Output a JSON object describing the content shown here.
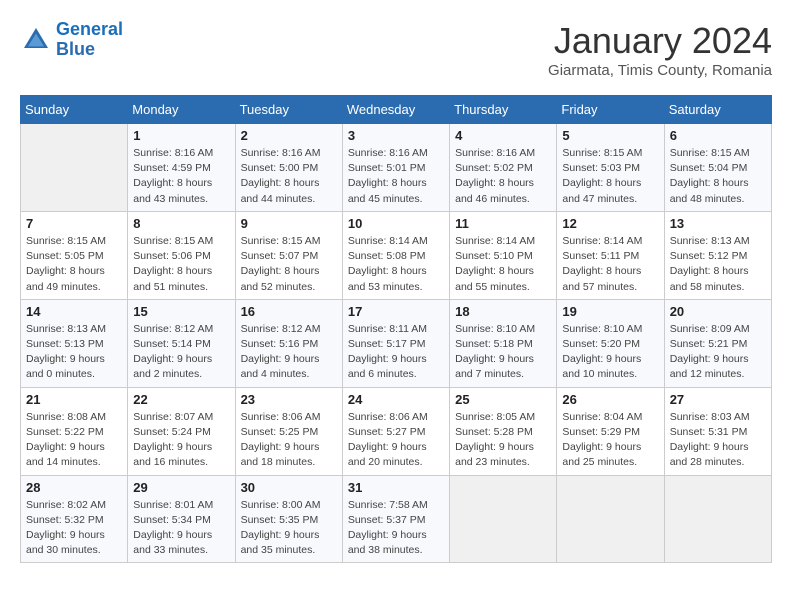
{
  "header": {
    "logo_line1": "General",
    "logo_line2": "Blue",
    "month": "January 2024",
    "location": "Giarmata, Timis County, Romania"
  },
  "weekdays": [
    "Sunday",
    "Monday",
    "Tuesday",
    "Wednesday",
    "Thursday",
    "Friday",
    "Saturday"
  ],
  "weeks": [
    [
      {
        "day": "",
        "info": ""
      },
      {
        "day": "1",
        "info": "Sunrise: 8:16 AM\nSunset: 4:59 PM\nDaylight: 8 hours\nand 43 minutes."
      },
      {
        "day": "2",
        "info": "Sunrise: 8:16 AM\nSunset: 5:00 PM\nDaylight: 8 hours\nand 44 minutes."
      },
      {
        "day": "3",
        "info": "Sunrise: 8:16 AM\nSunset: 5:01 PM\nDaylight: 8 hours\nand 45 minutes."
      },
      {
        "day": "4",
        "info": "Sunrise: 8:16 AM\nSunset: 5:02 PM\nDaylight: 8 hours\nand 46 minutes."
      },
      {
        "day": "5",
        "info": "Sunrise: 8:15 AM\nSunset: 5:03 PM\nDaylight: 8 hours\nand 47 minutes."
      },
      {
        "day": "6",
        "info": "Sunrise: 8:15 AM\nSunset: 5:04 PM\nDaylight: 8 hours\nand 48 minutes."
      }
    ],
    [
      {
        "day": "7",
        "info": "Sunrise: 8:15 AM\nSunset: 5:05 PM\nDaylight: 8 hours\nand 49 minutes."
      },
      {
        "day": "8",
        "info": "Sunrise: 8:15 AM\nSunset: 5:06 PM\nDaylight: 8 hours\nand 51 minutes."
      },
      {
        "day": "9",
        "info": "Sunrise: 8:15 AM\nSunset: 5:07 PM\nDaylight: 8 hours\nand 52 minutes."
      },
      {
        "day": "10",
        "info": "Sunrise: 8:14 AM\nSunset: 5:08 PM\nDaylight: 8 hours\nand 53 minutes."
      },
      {
        "day": "11",
        "info": "Sunrise: 8:14 AM\nSunset: 5:10 PM\nDaylight: 8 hours\nand 55 minutes."
      },
      {
        "day": "12",
        "info": "Sunrise: 8:14 AM\nSunset: 5:11 PM\nDaylight: 8 hours\nand 57 minutes."
      },
      {
        "day": "13",
        "info": "Sunrise: 8:13 AM\nSunset: 5:12 PM\nDaylight: 8 hours\nand 58 minutes."
      }
    ],
    [
      {
        "day": "14",
        "info": "Sunrise: 8:13 AM\nSunset: 5:13 PM\nDaylight: 9 hours\nand 0 minutes."
      },
      {
        "day": "15",
        "info": "Sunrise: 8:12 AM\nSunset: 5:14 PM\nDaylight: 9 hours\nand 2 minutes."
      },
      {
        "day": "16",
        "info": "Sunrise: 8:12 AM\nSunset: 5:16 PM\nDaylight: 9 hours\nand 4 minutes."
      },
      {
        "day": "17",
        "info": "Sunrise: 8:11 AM\nSunset: 5:17 PM\nDaylight: 9 hours\nand 6 minutes."
      },
      {
        "day": "18",
        "info": "Sunrise: 8:10 AM\nSunset: 5:18 PM\nDaylight: 9 hours\nand 7 minutes."
      },
      {
        "day": "19",
        "info": "Sunrise: 8:10 AM\nSunset: 5:20 PM\nDaylight: 9 hours\nand 10 minutes."
      },
      {
        "day": "20",
        "info": "Sunrise: 8:09 AM\nSunset: 5:21 PM\nDaylight: 9 hours\nand 12 minutes."
      }
    ],
    [
      {
        "day": "21",
        "info": "Sunrise: 8:08 AM\nSunset: 5:22 PM\nDaylight: 9 hours\nand 14 minutes."
      },
      {
        "day": "22",
        "info": "Sunrise: 8:07 AM\nSunset: 5:24 PM\nDaylight: 9 hours\nand 16 minutes."
      },
      {
        "day": "23",
        "info": "Sunrise: 8:06 AM\nSunset: 5:25 PM\nDaylight: 9 hours\nand 18 minutes."
      },
      {
        "day": "24",
        "info": "Sunrise: 8:06 AM\nSunset: 5:27 PM\nDaylight: 9 hours\nand 20 minutes."
      },
      {
        "day": "25",
        "info": "Sunrise: 8:05 AM\nSunset: 5:28 PM\nDaylight: 9 hours\nand 23 minutes."
      },
      {
        "day": "26",
        "info": "Sunrise: 8:04 AM\nSunset: 5:29 PM\nDaylight: 9 hours\nand 25 minutes."
      },
      {
        "day": "27",
        "info": "Sunrise: 8:03 AM\nSunset: 5:31 PM\nDaylight: 9 hours\nand 28 minutes."
      }
    ],
    [
      {
        "day": "28",
        "info": "Sunrise: 8:02 AM\nSunset: 5:32 PM\nDaylight: 9 hours\nand 30 minutes."
      },
      {
        "day": "29",
        "info": "Sunrise: 8:01 AM\nSunset: 5:34 PM\nDaylight: 9 hours\nand 33 minutes."
      },
      {
        "day": "30",
        "info": "Sunrise: 8:00 AM\nSunset: 5:35 PM\nDaylight: 9 hours\nand 35 minutes."
      },
      {
        "day": "31",
        "info": "Sunrise: 7:58 AM\nSunset: 5:37 PM\nDaylight: 9 hours\nand 38 minutes."
      },
      {
        "day": "",
        "info": ""
      },
      {
        "day": "",
        "info": ""
      },
      {
        "day": "",
        "info": ""
      }
    ]
  ]
}
